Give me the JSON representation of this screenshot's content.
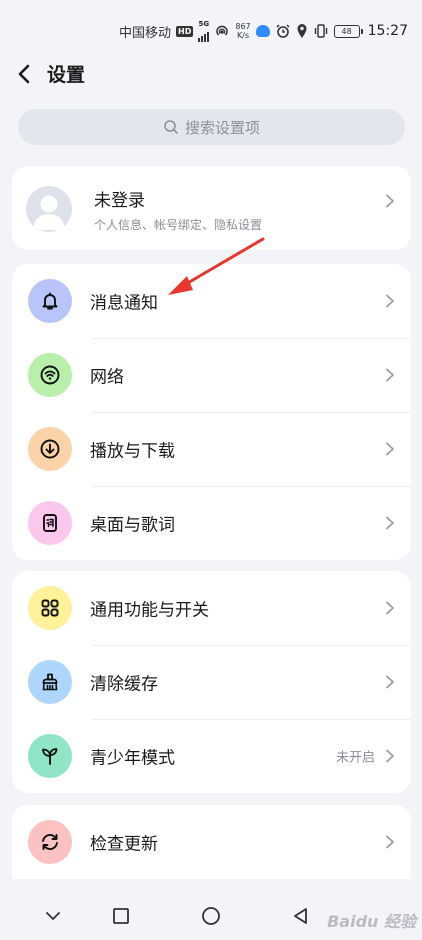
{
  "status_bar": {
    "carrier": "中国移动",
    "hd": "HD",
    "network": "5G",
    "speed_value": "867",
    "speed_unit": "K/s",
    "battery": "48",
    "time": "15:27"
  },
  "header": {
    "title": "设置"
  },
  "search": {
    "placeholder": "搜索设置项"
  },
  "profile": {
    "name": "未登录",
    "subtitle": "个人信息、帐号绑定、隐私设置"
  },
  "groups": [
    {
      "items": [
        {
          "label": "消息通知",
          "icon": "bell-icon",
          "color": "#b9c4fb"
        },
        {
          "label": "网络",
          "icon": "wifi-icon",
          "color": "#b8efaa"
        },
        {
          "label": "播放与下载",
          "icon": "download-icon",
          "color": "#fcd2a8"
        },
        {
          "label": "桌面与歌词",
          "icon": "lyrics-icon",
          "color": "#fbc7ec"
        }
      ]
    },
    {
      "items": [
        {
          "label": "通用功能与开关",
          "icon": "grid-icon",
          "color": "#fdf19a"
        },
        {
          "label": "清除缓存",
          "icon": "broom-icon",
          "color": "#aed6fb"
        },
        {
          "label": "青少年模式",
          "icon": "sprout-icon",
          "color": "#8fe5c5",
          "value": "未开启"
        }
      ]
    },
    {
      "items": [
        {
          "label": "检查更新",
          "icon": "refresh-icon",
          "color": "#fcc2c2"
        }
      ]
    }
  ],
  "watermark": "Baidu 经验",
  "colors": {
    "accent_arrow": "#e8362f",
    "background": "#f3f4f8"
  }
}
